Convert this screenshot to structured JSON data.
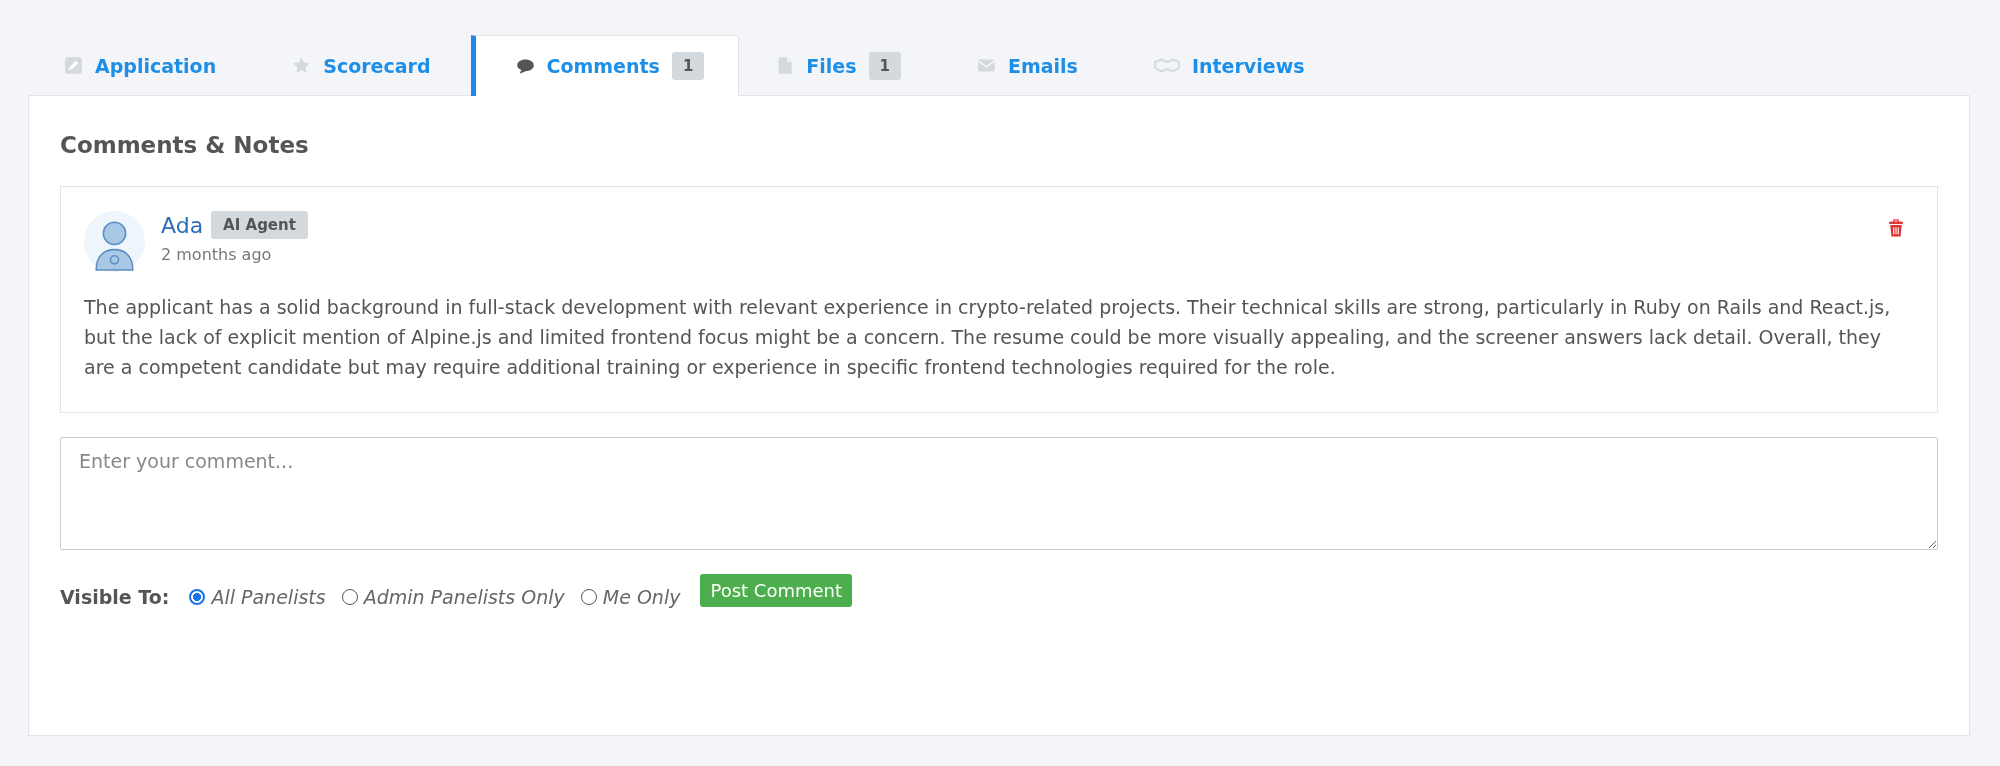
{
  "tabs": [
    {
      "label": "Application",
      "selected": false
    },
    {
      "label": "Scorecard",
      "selected": false
    },
    {
      "label": "Comments",
      "badge": "1",
      "selected": true
    },
    {
      "label": "Files",
      "badge": "1",
      "selected": false
    },
    {
      "label": "Emails",
      "selected": false
    },
    {
      "label": "Interviews",
      "selected": false
    }
  ],
  "heading": "Comments & Notes",
  "comments": [
    {
      "author": "Ada",
      "tag": "AI Agent",
      "time": "2 months ago",
      "text": "The applicant has a solid background in full-stack development with relevant experience in crypto-related projects. Their technical skills are strong, particularly in Ruby on Rails and React.js, but the lack of explicit mention of Alpine.js and limited frontend focus might be a concern. The resume could be more visually appealing, and the screener answers lack detail. Overall, they are a competent candidate but may require additional training or experience in specific frontend technologies required for the role."
    }
  ],
  "comment_field": {
    "placeholder": "Enter your comment..."
  },
  "visibility": {
    "label": "Visible To:",
    "options": [
      {
        "label": "All Panelists",
        "selected": true
      },
      {
        "label": "Admin Panelists Only",
        "selected": false
      },
      {
        "label": "Me Only",
        "selected": false
      }
    ]
  },
  "post_button": "Post Comment"
}
